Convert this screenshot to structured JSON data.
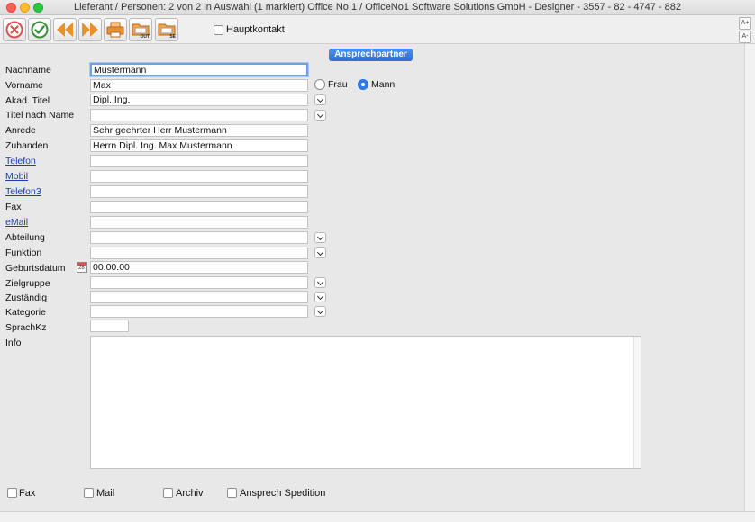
{
  "window": {
    "title": "Lieferant / Personen: 2 von 2 in Auswahl  (1 markiert) Office No 1 /  OfficeNo1 Software Solutions GmbH - Designer - 3557 - 82 - 4747 - 882"
  },
  "toolbar": {
    "buttons": [
      {
        "icon": "cancel-icon"
      },
      {
        "icon": "confirm-icon"
      },
      {
        "icon": "previous-icon"
      },
      {
        "icon": "next-icon"
      },
      {
        "icon": "print-icon"
      },
      {
        "icon": "export-out-icon",
        "badge": "OUT"
      },
      {
        "icon": "export-se-icon",
        "badge": "SE"
      }
    ],
    "hauptkontakt_label": "Hauptkontakt",
    "hauptkontakt_checked": false
  },
  "side_buttons": {
    "font_up": "A+",
    "font_down": "A-"
  },
  "section": {
    "header": "Ansprechpartner"
  },
  "form": {
    "nachname": {
      "label": "Nachname",
      "value": "Mustermann"
    },
    "vorname": {
      "label": "Vorname",
      "value": "Max"
    },
    "gender": {
      "frau": "Frau",
      "mann": "Mann",
      "selected": "Mann"
    },
    "akad_titel": {
      "label": "Akad. Titel",
      "value": "Dipl. Ing."
    },
    "titel_nach_name": {
      "label": "Titel nach Name",
      "value": ""
    },
    "anrede": {
      "label": "Anrede",
      "value": "Sehr geehrter Herr Mustermann"
    },
    "zuhanden": {
      "label": "Zuhanden",
      "value": "Herrn Dipl. Ing. Max Mustermann"
    },
    "telefon": {
      "label": "Telefon",
      "value": ""
    },
    "mobil": {
      "label": "Mobil",
      "value": ""
    },
    "telefon3": {
      "label": "Telefon3",
      "value": ""
    },
    "fax": {
      "label": "Fax",
      "value": ""
    },
    "email": {
      "label": "eMail",
      "value": ""
    },
    "abteilung": {
      "label": "Abteilung",
      "value": ""
    },
    "funktion": {
      "label": "Funktion",
      "value": ""
    },
    "geburtsdatum": {
      "label": "Geburtsdatum",
      "value": "00.00.00",
      "cal_text": "28"
    },
    "zielgruppe": {
      "label": "Zielgruppe",
      "value": ""
    },
    "zustaendig": {
      "label": "Zuständig",
      "value": ""
    },
    "kategorie": {
      "label": "Kategorie",
      "value": ""
    },
    "sprachkz": {
      "label": "SprachKz",
      "value": ""
    },
    "info": {
      "label": "Info",
      "value": ""
    }
  },
  "bottom_checks": {
    "fax": "Fax",
    "mail": "Mail",
    "archiv": "Archiv",
    "ansprech_spedition": "Ansprech Spedition"
  },
  "colors": {
    "section_header": "#2c6fd8",
    "link": "#1a3db2",
    "cancel": "#d9534f",
    "confirm": "#3a8f3a",
    "nav": "#e8902a"
  }
}
